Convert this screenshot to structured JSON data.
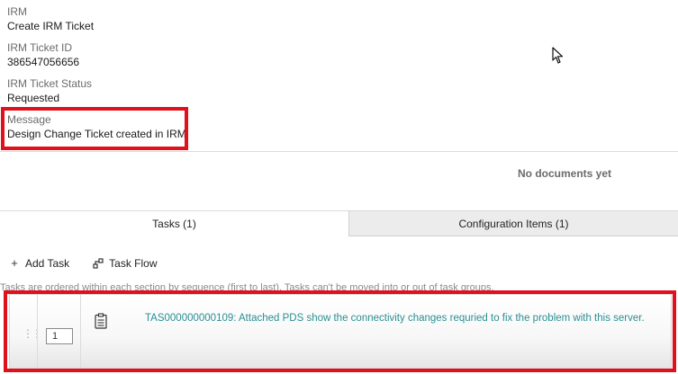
{
  "fields": [
    {
      "label": "IRM",
      "value": "Create IRM Ticket"
    },
    {
      "label": "IRM Ticket ID",
      "value": "386547056656"
    },
    {
      "label": "IRM Ticket Status",
      "value": "Requested"
    },
    {
      "label": "Message",
      "value": "Design Change Ticket created in IRM"
    }
  ],
  "documents": {
    "empty_text": "No documents yet"
  },
  "tabs": [
    {
      "label": "Tasks (1)",
      "active": true
    },
    {
      "label": "Configuration Items (1)",
      "active": false
    }
  ],
  "toolbar": {
    "add_task": "Add Task",
    "task_flow": "Task Flow"
  },
  "hint": "Tasks are ordered within each section by sequence (first to last). Tasks can't be moved into or out of task groups.",
  "task": {
    "sequence": "1",
    "title": "TAS000000000109: Attached PDS show the connectivity changes requried to fix the problem with this server."
  },
  "colors": {
    "highlight": "#e0101c",
    "link": "#2a8f93"
  }
}
